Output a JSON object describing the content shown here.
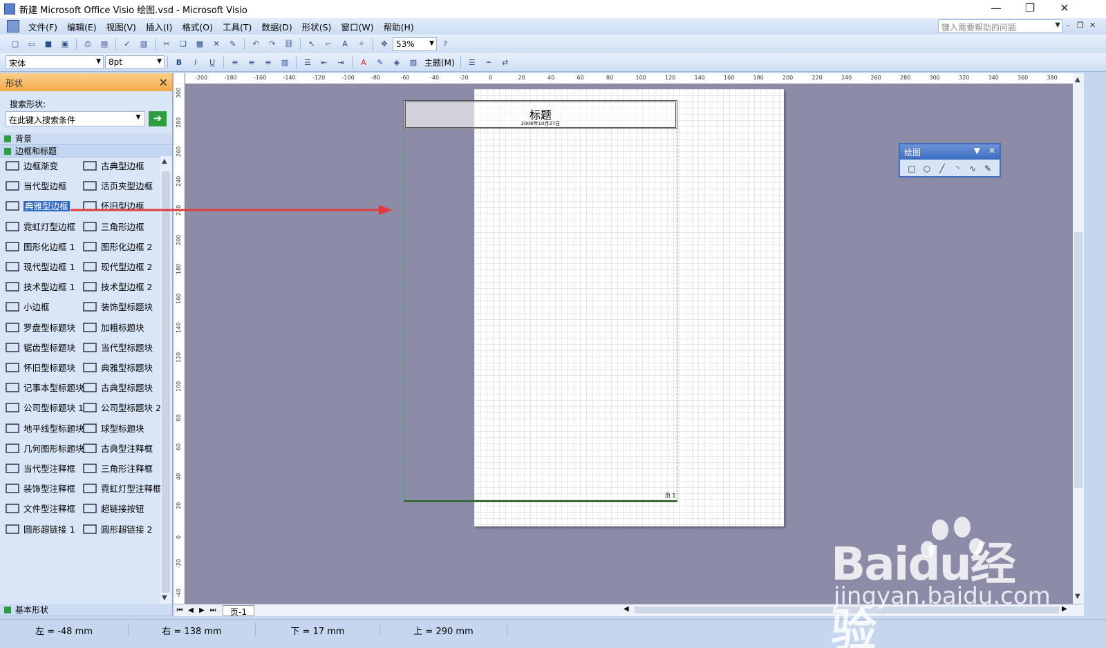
{
  "window": {
    "title": "新建 Microsoft Office Visio 绘图.vsd - Microsoft Visio"
  },
  "menu": {
    "items": [
      "文件(F)",
      "编辑(E)",
      "视图(V)",
      "插入(I)",
      "格式(O)",
      "工具(T)",
      "数据(D)",
      "形状(S)",
      "窗口(W)",
      "帮助(H)"
    ],
    "help_placeholder": "键入需要帮助的问题"
  },
  "toolbar1": {
    "zoom": "53%"
  },
  "toolbar2": {
    "font": "宋体",
    "size": "8pt",
    "theme_label": "主题(M)"
  },
  "shapes_panel": {
    "title": "形状",
    "search_label": "搜索形状:",
    "search_placeholder": "在此键入搜索条件",
    "stencils": [
      "背景",
      "边框和标题"
    ],
    "bottom_stencil": "基本形状",
    "items": [
      [
        "边框渐变",
        "古典型边框"
      ],
      [
        "当代型边框",
        "活页夹型边框"
      ],
      [
        "典雅型边框",
        "怀旧型边框"
      ],
      [
        "霓虹灯型边框",
        "三角形边框"
      ],
      [
        "图形化边框 1",
        "图形化边框 2"
      ],
      [
        "现代型边框 1",
        "现代型边框 2"
      ],
      [
        "技术型边框 1",
        "技术型边框 2"
      ],
      [
        "小边框",
        "装饰型标题块"
      ],
      [
        "罗盘型标题块",
        "加粗标题块"
      ],
      [
        "锯齿型标题块",
        "当代型标题块"
      ],
      [
        "怀旧型标题块",
        "典雅型标题块"
      ],
      [
        "记事本型标题块",
        "古典型标题块"
      ],
      [
        "公司型标题块 1",
        "公司型标题块 2"
      ],
      [
        "地平线型标题块",
        "球型标题块"
      ],
      [
        "几何图形标题块",
        "古典型注释框"
      ],
      [
        "当代型注释框",
        "三角形注释框"
      ],
      [
        "装饰型注释框",
        "霓虹灯型注释框"
      ],
      [
        "文件型注释框",
        "超链接按钮"
      ],
      [
        "圆形超链接 1",
        "圆形超链接 2"
      ]
    ],
    "selected": "典雅型边框"
  },
  "ruler_h": [
    "-200",
    "-180",
    "-160",
    "-140",
    "-120",
    "-100",
    "-80",
    "-60",
    "-40",
    "-20",
    "0",
    "20",
    "40",
    "60",
    "80",
    "100",
    "120",
    "140",
    "160",
    "180",
    "200",
    "220",
    "240",
    "260",
    "280",
    "300",
    "320",
    "340",
    "360",
    "380"
  ],
  "ruler_v": [
    "300",
    "280",
    "260",
    "240",
    "220",
    "200",
    "180",
    "160",
    "140",
    "120",
    "100",
    "80",
    "60",
    "40",
    "20",
    "0",
    "-20",
    "-40"
  ],
  "canvas": {
    "title_text": "标题",
    "date_text": "2006年10月27日",
    "page_number": "页 1"
  },
  "drawing_toolbar": {
    "title": "绘图"
  },
  "page_tabs": {
    "tab": "页-1"
  },
  "status": {
    "left": "左 = -48 mm",
    "right": "右 = 138 mm",
    "bottom": "下 = 17 mm",
    "top": "上 = 290 mm"
  },
  "watermark": {
    "brand": "Baidu经验",
    "url": "jingyan.baidu.com"
  }
}
